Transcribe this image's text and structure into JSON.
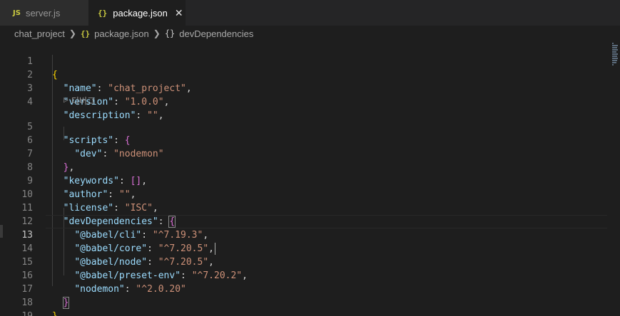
{
  "tabs": [
    {
      "icon": "JS",
      "label": "server.js",
      "active": false
    },
    {
      "icon": "{}",
      "label": "package.json",
      "active": true,
      "close": "✕"
    }
  ],
  "breadcrumb": {
    "folder": "chat_project",
    "file_icon": "{}",
    "file": "package.json",
    "symbol_icon": "{}",
    "symbol": "devDependencies"
  },
  "editor": {
    "active_line": 13,
    "codelens_label": "디버그",
    "lines": [
      {
        "n": "1"
      },
      {
        "n": "2"
      },
      {
        "n": "3"
      },
      {
        "n": "4"
      },
      {
        "n": "5"
      },
      {
        "n": "6"
      },
      {
        "n": "7"
      },
      {
        "n": "8"
      },
      {
        "n": "9"
      },
      {
        "n": "10"
      },
      {
        "n": "11"
      },
      {
        "n": "12"
      },
      {
        "n": "13"
      },
      {
        "n": "14"
      },
      {
        "n": "15"
      },
      {
        "n": "16"
      },
      {
        "n": "17"
      },
      {
        "n": "18"
      },
      {
        "n": "19"
      }
    ],
    "tokens": {
      "name_key": "\"name\"",
      "name_val": "\"chat_project\"",
      "version_key": "\"version\"",
      "version_val": "\"1.0.0\"",
      "description_key": "\"description\"",
      "description_val": "\"\"",
      "scripts_key": "\"scripts\"",
      "dev_key": "\"dev\"",
      "dev_val": "\"nodemon\"",
      "keywords_key": "\"keywords\"",
      "author_key": "\"author\"",
      "author_val": "\"\"",
      "license_key": "\"license\"",
      "license_val": "\"ISC\"",
      "devdeps_key": "\"devDependencies\"",
      "cli_key": "\"@babel/cli\"",
      "cli_val": "\"^7.19.3\"",
      "core_key": "\"@babel/core\"",
      "core_val": "\"^7.20.5\"",
      "node_key": "\"@babel/node\"",
      "node_val": "\"^7.20.5\"",
      "preset_key": "\"@babel/preset-env\"",
      "preset_val": "\"^7.20.2\"",
      "nodemon_key": "\"nodemon\"",
      "nodemon_val": "\"^2.0.20\""
    }
  },
  "colors": {
    "background": "#1e1e1e",
    "key": "#9cdcfe",
    "string": "#ce9178",
    "bracket_gold": "#ffd700",
    "bracket_orchid": "#da70d6"
  }
}
